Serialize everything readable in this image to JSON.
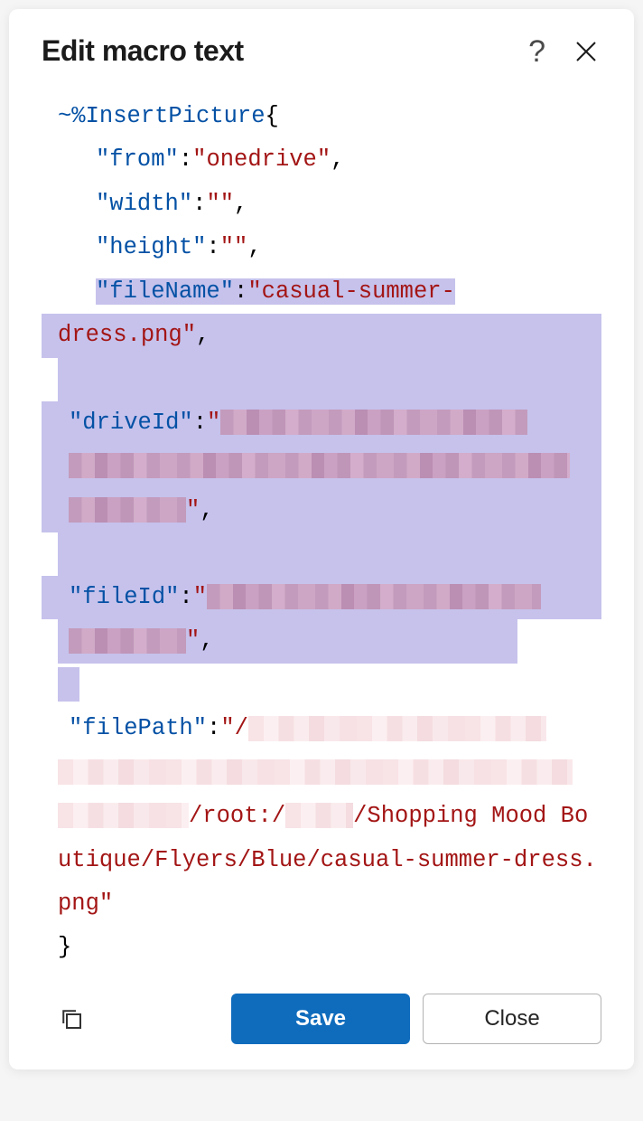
{
  "dialog": {
    "title": "Edit macro text"
  },
  "code": {
    "directive": "~%InsertPicture",
    "open": "{",
    "close": "}",
    "keys": {
      "from": "\"from\"",
      "width": "\"width\"",
      "height": "\"height\"",
      "fileName": "\"fileName\"",
      "driveId": "\"driveId\"",
      "fileId": "\"fileId\"",
      "filePath": "\"filePath\""
    },
    "values": {
      "from": "\"onedrive\"",
      "width": "\"\"",
      "height": "\"\"",
      "fileName_part1": "\"casual-summer-",
      "fileName_part2": "dress.png\"",
      "driveId_open": "\"",
      "driveId_close": "\"",
      "fileId_open": "\"",
      "fileId_close": "\"",
      "filePath_open": "\"/",
      "filePath_mid1": "/root:/",
      "filePath_mid2": "/Shopping Mood Boutique/Flyers/Blue/casual-summer-dress.png\""
    },
    "comma": ","
  },
  "buttons": {
    "save": "Save",
    "close": "Close"
  }
}
